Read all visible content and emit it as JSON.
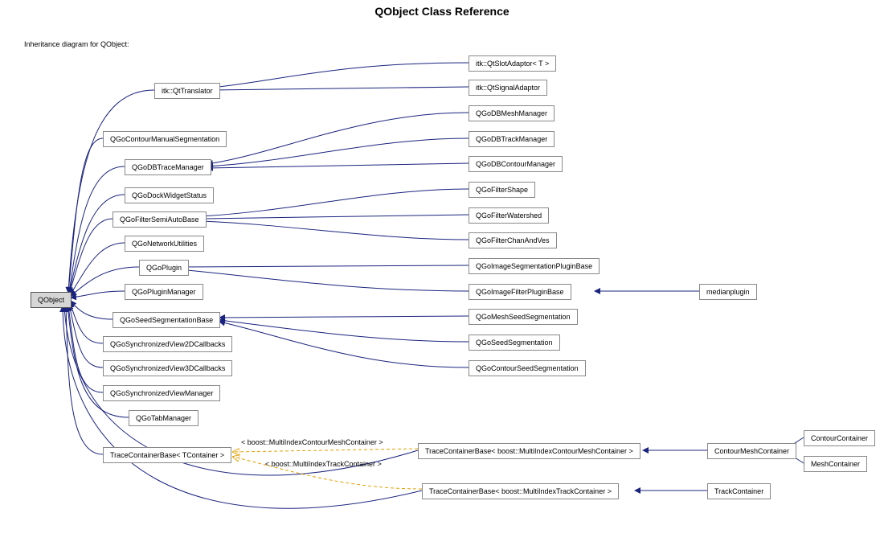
{
  "title": "QObject Class Reference",
  "caption": "Inheritance diagram for QObject:",
  "root": {
    "label": "QObject"
  },
  "col1": {
    "QtTranslator": "itk::QtTranslator",
    "QGoContourManualSegmentation": "QGoContourManualSegmentation",
    "QGoDBTraceManager": "QGoDBTraceManager",
    "QGoDockWidgetStatus": "QGoDockWidgetStatus",
    "QGoFilterSemiAutoBase": "QGoFilterSemiAutoBase",
    "QGoNetworkUtilities": "QGoNetworkUtilities",
    "QGoPlugin": "QGoPlugin",
    "QGoPluginManager": "QGoPluginManager",
    "QGoSeedSegmentationBase": "QGoSeedSegmentationBase",
    "QGoSynchronizedView2DCallbacks": "QGoSynchronizedView2DCallbacks",
    "QGoSynchronizedView3DCallbacks": "QGoSynchronizedView3DCallbacks",
    "QGoSynchronizedViewManager": "QGoSynchronizedViewManager",
    "QGoTabManager": "QGoTabManager",
    "TraceContainerBaseT": "TraceContainerBase< TContainer >"
  },
  "col2": {
    "QtSlotAdaptor": "itk::QtSlotAdaptor< T >",
    "QtSignalAdaptor": "itk::QtSignalAdaptor",
    "QGoDBMeshManager": "QGoDBMeshManager",
    "QGoDBTrackManager": "QGoDBTrackManager",
    "QGoDBContourManager": "QGoDBContourManager",
    "QGoFilterShape": "QGoFilterShape",
    "QGoFilterWatershed": "QGoFilterWatershed",
    "QGoFilterChanAndVes": "QGoFilterChanAndVes",
    "QGoImageSegmentationPluginBase": "QGoImageSegmentationPluginBase",
    "QGoImageFilterPluginBase": "QGoImageFilterPluginBase",
    "QGoMeshSeedSegmentation": "QGoMeshSeedSegmentation",
    "QGoSeedSegmentation": "QGoSeedSegmentation",
    "QGoContourSeedSegmentation": "QGoContourSeedSegmentation",
    "TCBContourMesh": "TraceContainerBase< boost::MultiIndexContourMeshContainer >",
    "TCBTrack": "TraceContainerBase< boost::MultiIndexTrackContainer >"
  },
  "col3": {
    "medianplugin": "medianplugin",
    "ContourMeshContainer": "ContourMeshContainer",
    "TrackContainer": "TrackContainer"
  },
  "col4": {
    "ContourContainer": "ContourContainer",
    "MeshContainer": "MeshContainer"
  },
  "tparams": {
    "contourMesh": "< boost::MultiIndexContourMeshContainer >",
    "track": "< boost::MultiIndexTrackContainer >"
  }
}
